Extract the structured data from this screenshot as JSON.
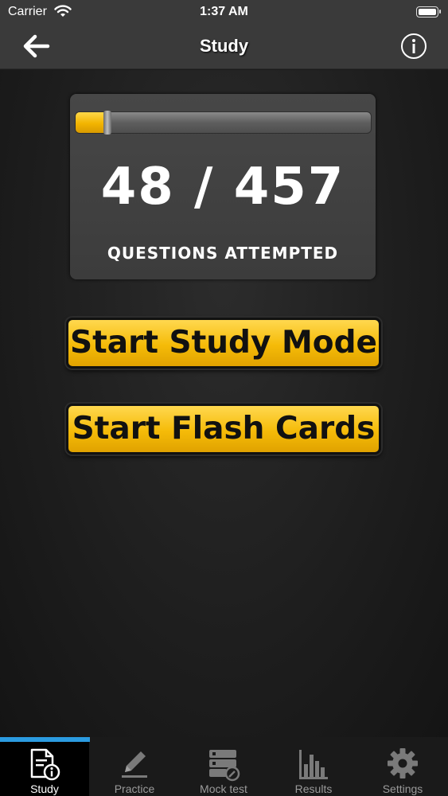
{
  "status_bar": {
    "carrier": "Carrier",
    "time": "1:37 AM"
  },
  "nav": {
    "title": "Study",
    "back_icon": "back-arrow-icon",
    "info_icon": "info-icon"
  },
  "progress": {
    "attempted": 48,
    "total": 457,
    "count_text": "48 / 457",
    "label": "QUESTIONS ATTEMPTED",
    "fraction": 0.105
  },
  "buttons": {
    "study_mode": "Start Study Mode",
    "flash_cards": "Start Flash Cards"
  },
  "tabs": [
    {
      "label": "Study",
      "icon": "study-document-icon",
      "active": true
    },
    {
      "label": "Practice",
      "icon": "pencil-icon",
      "active": false
    },
    {
      "label": "Mock test",
      "icon": "mock-test-icon",
      "active": false
    },
    {
      "label": "Results",
      "icon": "bar-chart-icon",
      "active": false
    },
    {
      "label": "Settings",
      "icon": "gear-icon",
      "active": false
    }
  ],
  "colors": {
    "accent_yellow": "#f5bb08",
    "tab_indicator": "#2b9be0",
    "nav_background": "#3a3a3a"
  }
}
